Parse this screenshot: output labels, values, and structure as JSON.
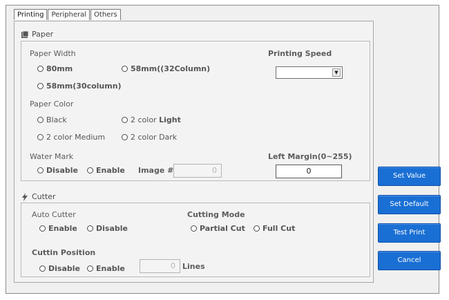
{
  "tabs": [
    "Printing",
    "Peripheral",
    "Others"
  ],
  "paper": {
    "title": "Paper",
    "paper_width_label": "Paper Width",
    "width_80": "80mm",
    "width_58_32": "58mm((32Column)",
    "width_58_30": "58mm(30column)",
    "printing_speed_label": "Printing Speed",
    "printing_speed_value": "",
    "paper_color_label": "Paper Color",
    "color_black": "Black",
    "color_light_prefix": "2 color ",
    "color_light_bold": "Light",
    "color_medium": "2 color Medium",
    "color_dark": "2 color Dark",
    "watermark_label": "Water Mark",
    "wm_disable": "Disable",
    "wm_enable": "Enable",
    "image_label": "Image #",
    "image_value": "0",
    "left_margin_label": "Left Margin(0~255)",
    "left_margin_value": "0"
  },
  "cutter": {
    "title": "Cutter",
    "auto_cutter_label": "Auto Cutter",
    "ac_enable": "Enable",
    "ac_disable": "Disable",
    "cutting_mode_label": "Cutting Mode",
    "partial_cut": "Partial Cut",
    "full_cut": "Full Cut",
    "cutting_position_label": "Cuttin Position",
    "cp_disable": "Disable",
    "cp_enable": "Enable",
    "cp_value": "0",
    "lines_label": "Lines"
  },
  "buttons": {
    "set_value": "Set Value",
    "set_default": "Set Default",
    "test_print": "Test Print",
    "cancel": "Cancel"
  }
}
